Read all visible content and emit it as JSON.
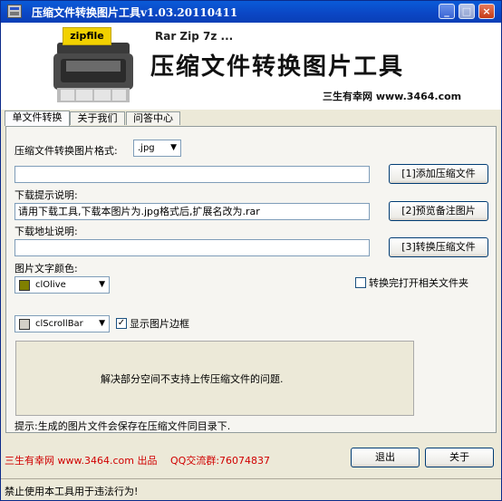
{
  "window": {
    "title": "压缩文件转换图片工具v1.03.20110411",
    "minimize_icon": "_",
    "maximize_icon": "□",
    "close_icon": "×"
  },
  "banner": {
    "logo_label": "zipfile",
    "tagline": "Rar Zip 7z ...",
    "title": "压缩文件转换图片工具",
    "footer": "三生有幸网 www.3464.com"
  },
  "tabs": [
    {
      "label": "单文件转换",
      "active": true
    },
    {
      "label": "关于我们",
      "active": false
    },
    {
      "label": "问答中心",
      "active": false
    }
  ],
  "form": {
    "format_label": "压缩文件转换图片格式:",
    "format_value": ".jpg",
    "file_path_value": "",
    "download_hint_label": "下载提示说明:",
    "download_hint_value": "请用下载工具,下载本图片为.jpg格式后,扩展名改为.rar",
    "download_url_label": "下载地址说明:",
    "download_url_value": "",
    "text_color_label": "图片文字颜色:",
    "text_color_value": "clOlive",
    "text_color_swatch": "#808000",
    "open_folder_label": "转换完打开相关文件夹",
    "open_folder_checked": false,
    "border_color_value": "clScrollBar",
    "border_color_swatch": "#d4d0c8",
    "show_border_label": "显示图片边框",
    "show_border_checked": true,
    "info_text": "解决部分空间不支持上传压缩文件的问题.",
    "tip": "提示:生成的图片文件会保存在压缩文件同目录下."
  },
  "buttons": {
    "add": "[1]添加压缩文件",
    "preview": "[2]预览备注图片",
    "convert": "[3]转换压缩文件",
    "exit": "退出",
    "about": "关于"
  },
  "credits": {
    "text": "三生有幸网 www.3464.com 出品",
    "qq": "QQ交流群:76074837",
    "color": "#d00000"
  },
  "status": {
    "text": "禁止使用本工具用于违法行为!"
  }
}
